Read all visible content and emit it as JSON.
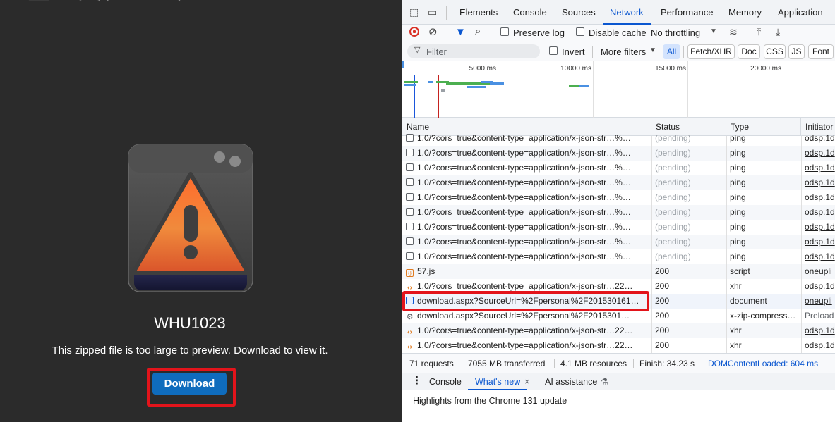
{
  "preview": {
    "file_name": "WHU1023",
    "message": "This zipped file is too large to preview. Download to view it.",
    "download_label": "Download"
  },
  "devtools": {
    "tabs": [
      "Elements",
      "Console",
      "Sources",
      "Network",
      "Performance",
      "Memory",
      "Application"
    ],
    "active_tab": "Network",
    "toolbar": {
      "preserve_log": "Preserve log",
      "disable_cache": "Disable cache",
      "throttling": "No throttling"
    },
    "filter": {
      "placeholder": "Filter",
      "invert": "Invert",
      "more_filters": "More filters",
      "chips": [
        "All",
        "Fetch/XHR",
        "Doc",
        "CSS",
        "JS",
        "Font"
      ]
    },
    "overview_ticks": [
      "5000 ms",
      "10000 ms",
      "15000 ms",
      "20000 ms"
    ],
    "columns": [
      "Name",
      "Status",
      "Type",
      "Initiator"
    ],
    "requests": [
      {
        "name": "1.0/?cors=true&content-type=application/x-json-str…%…",
        "status": "(pending)",
        "type": "ping",
        "initiator": "odsp.1d",
        "icon": "checkbox"
      },
      {
        "name": "1.0/?cors=true&content-type=application/x-json-str…%…",
        "status": "(pending)",
        "type": "ping",
        "initiator": "odsp.1d",
        "icon": "checkbox"
      },
      {
        "name": "1.0/?cors=true&content-type=application/x-json-str…%…",
        "status": "(pending)",
        "type": "ping",
        "initiator": "odsp.1d",
        "icon": "checkbox"
      },
      {
        "name": "1.0/?cors=true&content-type=application/x-json-str…%…",
        "status": "(pending)",
        "type": "ping",
        "initiator": "odsp.1d",
        "icon": "checkbox"
      },
      {
        "name": "1.0/?cors=true&content-type=application/x-json-str…%…",
        "status": "(pending)",
        "type": "ping",
        "initiator": "odsp.1d",
        "icon": "checkbox"
      },
      {
        "name": "1.0/?cors=true&content-type=application/x-json-str…%…",
        "status": "(pending)",
        "type": "ping",
        "initiator": "odsp.1d",
        "icon": "checkbox"
      },
      {
        "name": "1.0/?cors=true&content-type=application/x-json-str…%…",
        "status": "(pending)",
        "type": "ping",
        "initiator": "odsp.1d",
        "icon": "checkbox"
      },
      {
        "name": "1.0/?cors=true&content-type=application/x-json-str…%…",
        "status": "(pending)",
        "type": "ping",
        "initiator": "odsp.1d",
        "icon": "checkbox"
      },
      {
        "name": "1.0/?cors=true&content-type=application/x-json-str…%…",
        "status": "(pending)",
        "type": "ping",
        "initiator": "odsp.1d",
        "icon": "checkbox"
      },
      {
        "name": "57.js",
        "status": "200",
        "type": "script",
        "initiator": "oneupli",
        "icon": "script"
      },
      {
        "name": "1.0/?cors=true&content-type=application/x-json-str…22…",
        "status": "200",
        "type": "xhr",
        "initiator": "odsp.1d",
        "icon": "xhr"
      },
      {
        "name": "download.aspx?SourceUrl=%2Fpersonal%2F201530161…",
        "status": "200",
        "type": "document",
        "initiator": "oneupli",
        "icon": "document"
      },
      {
        "name": "download.aspx?SourceUrl=%2Fpersonal%2F2015301…",
        "status": "200",
        "type": "x-zip-compress…",
        "initiator": "Preload",
        "icon": "gear"
      },
      {
        "name": "1.0/?cors=true&content-type=application/x-json-str…22…",
        "status": "200",
        "type": "xhr",
        "initiator": "odsp.1d",
        "icon": "xhr"
      },
      {
        "name": "1.0/?cors=true&content-type=application/x-json-str…22…",
        "status": "200",
        "type": "xhr",
        "initiator": "odsp.1d",
        "icon": "xhr"
      }
    ],
    "status_bar": {
      "requests": "71 requests",
      "transferred": "7055 MB transferred",
      "resources": "4.1 MB resources",
      "finish": "Finish: 34.23 s",
      "dom_loaded": "DOMContentLoaded: 604 ms"
    },
    "drawer": {
      "tabs": [
        "Console",
        "What's new",
        "AI assistance"
      ],
      "active": "What's new",
      "content": "Highlights from the Chrome 131 update"
    }
  },
  "colors": {
    "highlight": "#e3141b",
    "download_button": "#0f6cbd",
    "devtools_accent": "#0b57d0",
    "preview_background": "#2b2b2b"
  }
}
